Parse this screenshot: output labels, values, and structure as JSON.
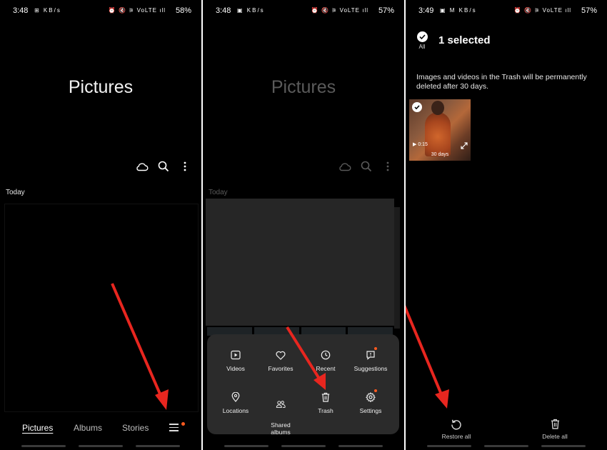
{
  "screen1": {
    "status": {
      "time": "3:48",
      "left_icons": "⊞ KB/s",
      "right_icons": "⏰ 🔇 ⚞ VoLTE ıll",
      "battery": "58%"
    },
    "title": "Pictures",
    "section_label": "Today",
    "nav": {
      "tabs": [
        "Pictures",
        "Albums",
        "Stories"
      ],
      "active": "Pictures"
    }
  },
  "screen2": {
    "status": {
      "time": "3:48",
      "left_icons": "▣ KB/s",
      "right_icons": "⏰ 🔇 ⚞ VoLTE ıll",
      "battery": "57%"
    },
    "title": "Pictures",
    "section_label": "Today",
    "menu": {
      "row1": [
        {
          "label": "Videos",
          "icon": "video-icon"
        },
        {
          "label": "Favorites",
          "icon": "heart-icon"
        },
        {
          "label": "Recent",
          "icon": "clock-icon"
        },
        {
          "label": "Suggestions",
          "icon": "suggestions-icon"
        }
      ],
      "row2": [
        {
          "label": "Locations",
          "icon": "location-pin-icon"
        },
        {
          "label": "Shared\nalbums",
          "icon": "people-icon"
        },
        {
          "label": "Trash",
          "icon": "trash-icon"
        },
        {
          "label": "Settings",
          "icon": "gear-icon"
        }
      ]
    }
  },
  "screen3": {
    "status": {
      "time": "3:49",
      "left_icons": "▣ M KB/s",
      "right_icons": "⏰ 🔇 ⚞ VoLTE ıll",
      "battery": "57%"
    },
    "all_label": "All",
    "selection_title": "1 selected",
    "note": "Images and videos in the Trash will be permanently deleted after 30 days.",
    "thumb": {
      "duration": "0:15",
      "days_left": "30 days"
    },
    "restore_label": "Restore all",
    "delete_label": "Delete all"
  },
  "colors": {
    "background": "#000000",
    "popup": "#2b2b2b",
    "badge": "#ff5a1f",
    "arrow": "#e8261f"
  }
}
